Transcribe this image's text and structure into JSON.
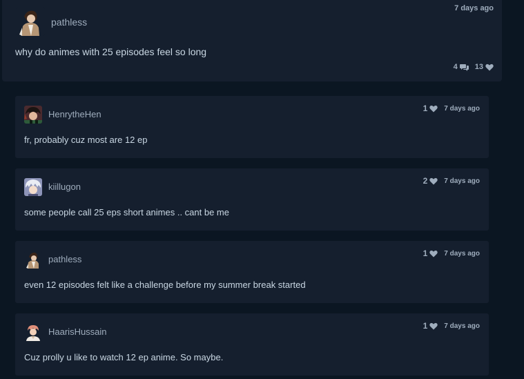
{
  "post": {
    "username": "pathless",
    "time": "7 days ago",
    "text": "why do animes with 25 episodes feel so long",
    "reply_count": "4",
    "like_count": "13"
  },
  "replies": [
    {
      "username": "HenrytheHen",
      "text": "fr, probably cuz most are 12 ep",
      "likes": "1",
      "time": "7 days ago",
      "avatar_icon": "henrythehen-avatar"
    },
    {
      "username": "kiillugon",
      "text": "some people call 25 eps short animes .. cant be me",
      "likes": "2",
      "time": "7 days ago",
      "avatar_icon": "kiillugon-avatar"
    },
    {
      "username": "pathless",
      "text": "even 12 episodes felt like a challenge before my summer break started",
      "likes": "1",
      "time": "7 days ago",
      "avatar_icon": "pathless-avatar"
    },
    {
      "username": "HaarisHussain",
      "text": "Cuz prolly u like to watch 12 ep anime. So maybe.",
      "likes": "1",
      "time": "7 days ago",
      "avatar_icon": "haarishussain-avatar"
    }
  ],
  "colors": {
    "page_background": "#0b1622",
    "card_background": "#151f2e",
    "text": "#c9d7e3",
    "muted_text": "#9fadbd"
  }
}
